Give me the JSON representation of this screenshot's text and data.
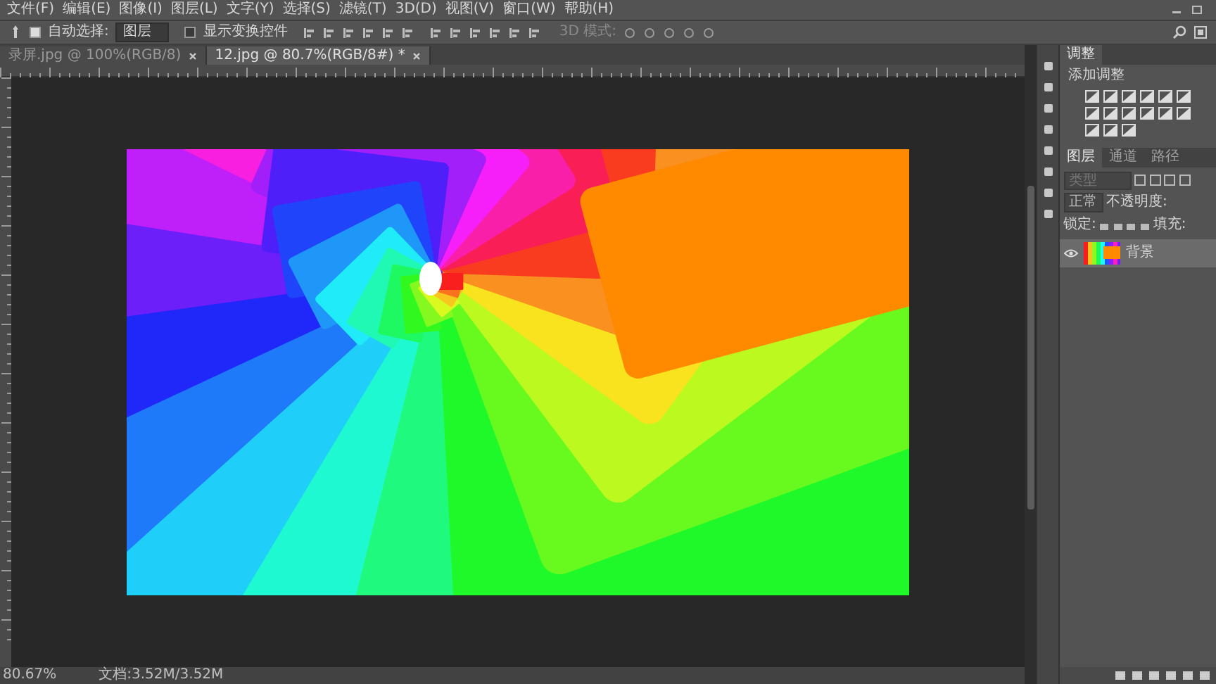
{
  "menu": [
    "文件(F)",
    "编辑(E)",
    "图像(I)",
    "图层(L)",
    "文字(Y)",
    "选择(S)",
    "滤镜(T)",
    "3D(D)",
    "视图(V)",
    "窗口(W)",
    "帮助(H)"
  ],
  "options": {
    "auto_select": {
      "label": "自动选择:",
      "checked": true
    },
    "target": {
      "value": "图层"
    },
    "show_transform": {
      "label": "显示变换控件",
      "checked": false
    },
    "mode_label": "3D 模式:"
  },
  "tabs": [
    {
      "label": "录屏.jpg @ 100%(RGB/8)",
      "selected": false
    },
    {
      "label": "12.jpg @ 80.7%(RGB/8#) *",
      "selected": true
    }
  ],
  "adjustments": {
    "tab": "调整",
    "heading": "添加调整"
  },
  "layers_panel": {
    "tabs": [
      {
        "label": "图层",
        "selected": true
      },
      {
        "label": "通道",
        "selected": false
      },
      {
        "label": "路径",
        "selected": false
      }
    ],
    "filter_placeholder": "类型",
    "blend_mode": "正常",
    "opacity_label": "不透明度:",
    "lock_label": "锁定:",
    "fill_label": "填充:",
    "layers": [
      {
        "name": "背景",
        "visible": true,
        "selected": true
      }
    ]
  },
  "status_bar": {
    "zoom": "80.67%",
    "document": "文档:3.52M/3.52M"
  }
}
